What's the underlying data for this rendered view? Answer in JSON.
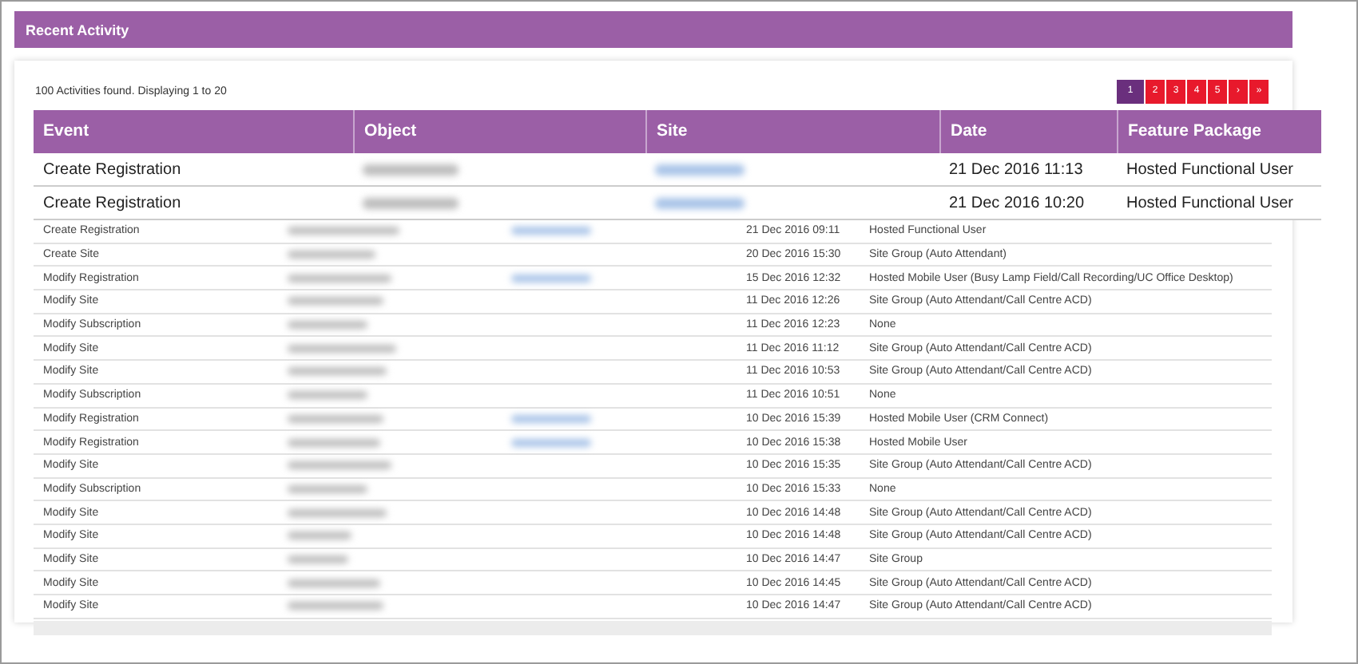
{
  "panel": {
    "title": "Recent Activity"
  },
  "summary": "100 Activities found. Displaying 1 to 20",
  "pagination": [
    {
      "label": "1",
      "selected": true
    },
    {
      "label": "2",
      "selected": false
    },
    {
      "label": "3",
      "selected": false
    },
    {
      "label": "4",
      "selected": false
    },
    {
      "label": "5",
      "selected": false
    },
    {
      "label": "›",
      "selected": false
    },
    {
      "label": "»",
      "selected": false
    }
  ],
  "table": {
    "columns": [
      "Event",
      "Object",
      "Site",
      "Date",
      "Feature Package"
    ],
    "highlighted_rows": [
      {
        "event": "Create Registration",
        "site_linked": true,
        "date": "21 Dec 2016 11:13",
        "feature_package": "Hosted Functional User"
      },
      {
        "event": "Create Registration",
        "site_linked": true,
        "date": "21 Dec 2016 10:20",
        "feature_package": "Hosted Functional User"
      }
    ],
    "rows": [
      {
        "event": "Create Registration",
        "site_linked": true,
        "date": "21 Dec 2016 09:11",
        "feature_package": "Hosted Functional User"
      },
      {
        "event": "Create Site",
        "site_linked": false,
        "date": "20 Dec 2016 15:30",
        "feature_package": "Site Group (Auto Attendant)"
      },
      {
        "event": "Modify Registration",
        "site_linked": true,
        "date": "15 Dec 2016 12:32",
        "feature_package": "Hosted Mobile User (Busy Lamp Field/Call Recording/UC Office Desktop)"
      },
      {
        "event": "Modify Site",
        "site_linked": false,
        "date": "11 Dec 2016 12:26",
        "feature_package": "Site Group (Auto Attendant/Call Centre ACD)"
      },
      {
        "event": "Modify Subscription",
        "site_linked": false,
        "date": "11 Dec 2016 12:23",
        "feature_package": "None"
      },
      {
        "event": "Modify Site",
        "site_linked": false,
        "date": "11 Dec 2016 11:12",
        "feature_package": "Site Group (Auto Attendant/Call Centre ACD)"
      },
      {
        "event": "Modify Site",
        "site_linked": false,
        "date": "11 Dec 2016 10:53",
        "feature_package": "Site Group (Auto Attendant/Call Centre ACD)"
      },
      {
        "event": "Modify Subscription",
        "site_linked": false,
        "date": "11 Dec 2016 10:51",
        "feature_package": "None"
      },
      {
        "event": "Modify Registration",
        "site_linked": true,
        "date": "10 Dec 2016 15:39",
        "feature_package": "Hosted Mobile User (CRM Connect)"
      },
      {
        "event": "Modify Registration",
        "site_linked": true,
        "date": "10 Dec 2016 15:38",
        "feature_package": "Hosted Mobile User"
      },
      {
        "event": "Modify Site",
        "site_linked": false,
        "date": "10 Dec 2016 15:35",
        "feature_package": "Site Group (Auto Attendant/Call Centre ACD)"
      },
      {
        "event": "Modify Subscription",
        "site_linked": false,
        "date": "10 Dec 2016 15:33",
        "feature_package": "None"
      },
      {
        "event": "Modify Site",
        "site_linked": false,
        "date": "10 Dec 2016 14:48",
        "feature_package": "Site Group (Auto Attendant/Call Centre ACD)"
      },
      {
        "event": "Modify Site",
        "site_linked": false,
        "date": "10 Dec 2016 14:48",
        "feature_package": "Site Group (Auto Attendant/Call Centre ACD)"
      },
      {
        "event": "Modify Site",
        "site_linked": false,
        "date": "10 Dec 2016 14:47",
        "feature_package": "Site Group"
      },
      {
        "event": "Modify Site",
        "site_linked": false,
        "date": "10 Dec 2016 14:45",
        "feature_package": "Site Group (Auto Attendant/Call Centre ACD)"
      },
      {
        "event": "Modify Site",
        "site_linked": false,
        "date": "10 Dec 2016 14:47",
        "feature_package": "Site Group (Auto Attendant/Call Centre ACD)"
      }
    ]
  }
}
